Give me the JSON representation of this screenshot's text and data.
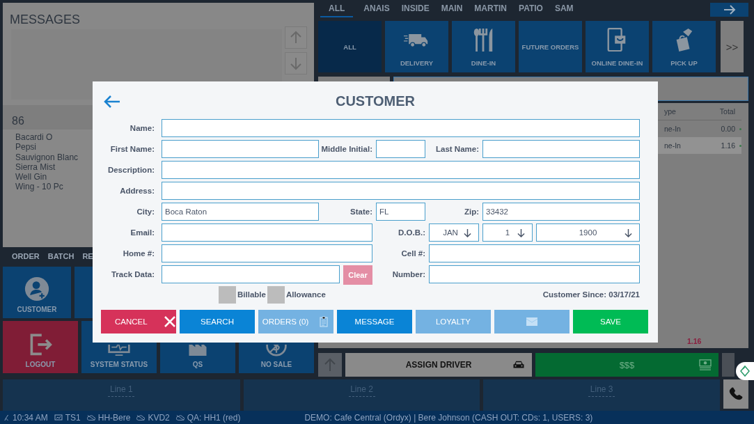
{
  "messages_panel": {
    "title": "MESSAGES"
  },
  "eighty_six": {
    "title": "86",
    "items": [
      "Bacardi O",
      "Pepsi",
      "Sauvignon Blanc",
      "Sierra Mist",
      "Well Gin",
      "Wing - 10 Pc"
    ]
  },
  "left_tabs": [
    "ORDER",
    "BATCH",
    "RE"
  ],
  "tile_rows": [
    [
      {
        "kind": "customer",
        "label": "CUSTOMER"
      },
      {
        "kind": "blank"
      }
    ],
    [
      {
        "kind": "logout",
        "label": "LOGOUT"
      },
      {
        "kind": "system-status",
        "label": "SYSTEM STATUS"
      },
      {
        "kind": "qs",
        "label": "QS"
      },
      {
        "kind": "no-sale",
        "label": "NO SALE"
      }
    ]
  ],
  "filter_tabs": [
    {
      "label": "ALL",
      "selected": true
    },
    {
      "label": "ANAIS",
      "selected": false
    },
    {
      "label": "INSIDE",
      "selected": false
    },
    {
      "label": "MAIN",
      "selected": false
    },
    {
      "label": "MARTIN",
      "selected": false
    },
    {
      "label": "PATIO",
      "selected": false
    },
    {
      "label": "SAM",
      "selected": false
    }
  ],
  "order_types": [
    {
      "kind": "all",
      "label": "ALL",
      "selected": true
    },
    {
      "kind": "delivery",
      "label": "DELIVERY",
      "selected": false
    },
    {
      "kind": "dine-in",
      "label": "DINE-IN",
      "selected": false
    },
    {
      "kind": "future",
      "label": "FUTURE ORDERS",
      "selected": false
    },
    {
      "kind": "online",
      "label": "ONLINE DINE-IN",
      "selected": false
    },
    {
      "kind": "pickup",
      "label": "PICK UP",
      "selected": false
    }
  ],
  "more_button": ">>",
  "orders_table": {
    "columns": [
      "ype",
      "Total"
    ],
    "rows": [
      {
        "cells": [
          "ne-In",
          "0.00"
        ],
        "selected": false
      },
      {
        "cells": [
          "ne-In",
          "1.16"
        ],
        "selected": true
      }
    ]
  },
  "balance_due": "1.16",
  "assign_driver": "ASSIGN DRIVER",
  "pay_button": "$$$",
  "lines": [
    "Line 1",
    "Line 2",
    "Line 3"
  ],
  "status_bar": {
    "items": [
      {
        "kind": "clock",
        "text": "10:34 AM"
      },
      {
        "kind": "terminal",
        "text": "TS1"
      },
      {
        "kind": "cloud",
        "text": "HH-Bere"
      },
      {
        "kind": "cloud",
        "text": "KVD2"
      },
      {
        "kind": "cloud",
        "text": "QA: HH1 (red)"
      }
    ],
    "info": "DEMO: Cafe Central (Ordyx) | Bere Johnson (CASH OUT: CDs: 1, USERS: 3)"
  },
  "dialog": {
    "title": "CUSTOMER",
    "rows": [
      {
        "fields": [
          {
            "label": "Name:",
            "kind": "input"
          }
        ]
      },
      {
        "fields": [
          {
            "label": "First Name:",
            "kind": "input"
          },
          {
            "label": "Middle Initial:",
            "kind": "input"
          },
          {
            "label": "Last Name:",
            "kind": "input"
          }
        ]
      },
      {
        "fields": [
          {
            "label": "Description:",
            "kind": "input"
          }
        ]
      },
      {
        "fields": [
          {
            "label": "Address:",
            "kind": "input"
          }
        ]
      },
      {
        "fields": [
          {
            "label": "City:",
            "kind": "input",
            "value": "Boca Raton"
          },
          {
            "label": "State:",
            "kind": "input",
            "value": "FL"
          },
          {
            "label": "Zip:",
            "kind": "input",
            "value": "33432"
          }
        ]
      },
      {
        "fields": [
          {
            "label": "Email:",
            "kind": "input"
          },
          {
            "label": "D.O.B.:",
            "kind": "date",
            "parts": [
              "JAN",
              "1",
              "1900"
            ]
          }
        ]
      },
      {
        "fields": [
          {
            "label": "Home #:",
            "kind": "input"
          },
          {
            "label": "Cell #:",
            "kind": "input"
          }
        ]
      },
      {
        "fields": [
          {
            "label": "Track Data:",
            "kind": "input",
            "button": {
              "text": "Clear",
              "disabled": true
            }
          },
          {
            "label": "Number:",
            "kind": "input"
          }
        ]
      }
    ],
    "checkboxes": [
      {
        "label": "Billable",
        "checked": false
      },
      {
        "label": "Allowance",
        "checked": false
      }
    ],
    "customer_since": "Customer Since: 03/17/21",
    "buttons": [
      {
        "kind": "cancel",
        "label": "CANCEL",
        "disabled": false
      },
      {
        "kind": "search",
        "label": "SEARCH",
        "disabled": false
      },
      {
        "kind": "orders",
        "label": "ORDERS (0)",
        "disabled": true
      },
      {
        "kind": "message",
        "label": "MESSAGE",
        "disabled": false
      },
      {
        "kind": "loyalty",
        "label": "LOYALTY",
        "disabled": true
      },
      {
        "kind": "card",
        "disabled": true
      },
      {
        "kind": "save",
        "label": "SAVE",
        "disabled": false
      }
    ]
  }
}
